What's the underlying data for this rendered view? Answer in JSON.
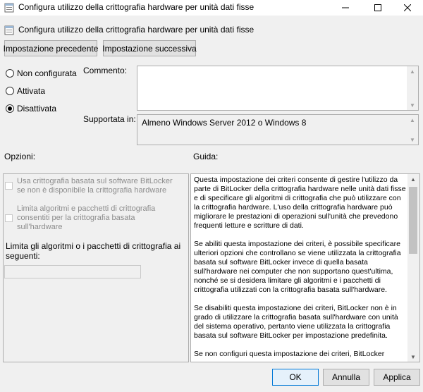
{
  "window": {
    "title": "Configura utilizzo della crittografia hardware per unità dati fisse",
    "controls": {
      "minimize": "—",
      "maximize": "☐",
      "close": "✕"
    }
  },
  "header": {
    "title": "Configura utilizzo della crittografia hardware per unità dati fisse",
    "prev_button": "Impostazione precedente",
    "next_button": "Impostazione successiva"
  },
  "state": {
    "options": [
      {
        "label": "Non configurata",
        "checked": false
      },
      {
        "label": "Attivata",
        "checked": false
      },
      {
        "label": "Disattivata",
        "checked": true
      }
    ]
  },
  "comment": {
    "label": "Commento:",
    "value": ""
  },
  "supported": {
    "label": "Supportata in:",
    "value": "Almeno Windows Server 2012 o Windows 8"
  },
  "options_section": {
    "label": "Opzioni:",
    "checkbox1": "Usa crittografia basata sul software BitLocker se non è disponibile la crittografia hardware",
    "checkbox2": "Limita algoritmi e pacchetti di crittografia consentiti per la crittografia basata sull'hardware",
    "limit_label": "Limita gli algoritmi o i pacchetti di crittografia ai seguenti:",
    "limit_value": ""
  },
  "guide": {
    "label": "Guida:",
    "paragraphs": [
      "Questa impostazione dei criteri consente di gestire l'utilizzo da parte di BitLocker della crittografia hardware nelle unità dati fisse e di specificare gli algoritmi di crittografia che può utilizzare con la crittografia hardware. L'uso della crittografia hardware può migliorare le prestazioni di operazioni sull'unità che prevedono frequenti letture e scritture di dati.",
      "Se abiliti questa impostazione dei criteri, è possibile specificare ulteriori opzioni che controllano se viene utilizzata la crittografia basata sul software BitLocker invece di quella basata sull'hardware nei computer che non supportano quest'ultima, nonché se si desidera limitare gli algoritmi e i pacchetti di crittografia utilizzati con la crittografia basata sull'hardware.",
      "Se disabiliti questa impostazione dei criteri, BitLocker non è in grado di utilizzare la crittografia basata sull'hardware con unità del sistema operativo, pertanto viene utilizzata la crittografia basata sul software BitLocker per impostazione predefinita.",
      "Se non configuri questa impostazione dei criteri, BitLocker"
    ]
  },
  "footer": {
    "ok": "OK",
    "cancel": "Annulla",
    "apply": "Applica"
  }
}
